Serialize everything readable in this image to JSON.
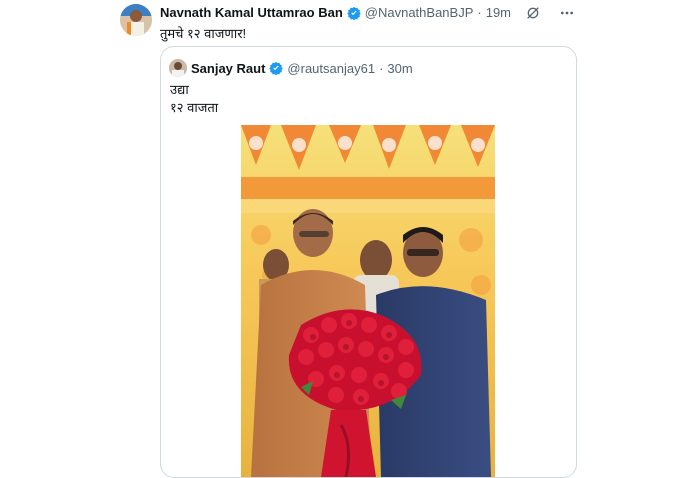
{
  "tweet": {
    "author_name": "Navnath Kamal Uttamrao Ban",
    "handle": "@NavnathBanBJP",
    "separator": "·",
    "time": "19m",
    "text": "तुमचे १२ वाजणार!"
  },
  "quote": {
    "author_name": "Sanjay Raut",
    "handle": "@rautsanjay61",
    "separator": "·",
    "time": "30m",
    "lines": [
      "उद्या",
      "१२ वाजता"
    ]
  },
  "icons": {
    "verified": "verified-badge-icon",
    "grok": "grok-icon",
    "more": "more-icon"
  },
  "colors": {
    "verified": "#1d9bf0",
    "text": "#0f1419",
    "muted": "#536471",
    "border": "#cfd9de"
  }
}
